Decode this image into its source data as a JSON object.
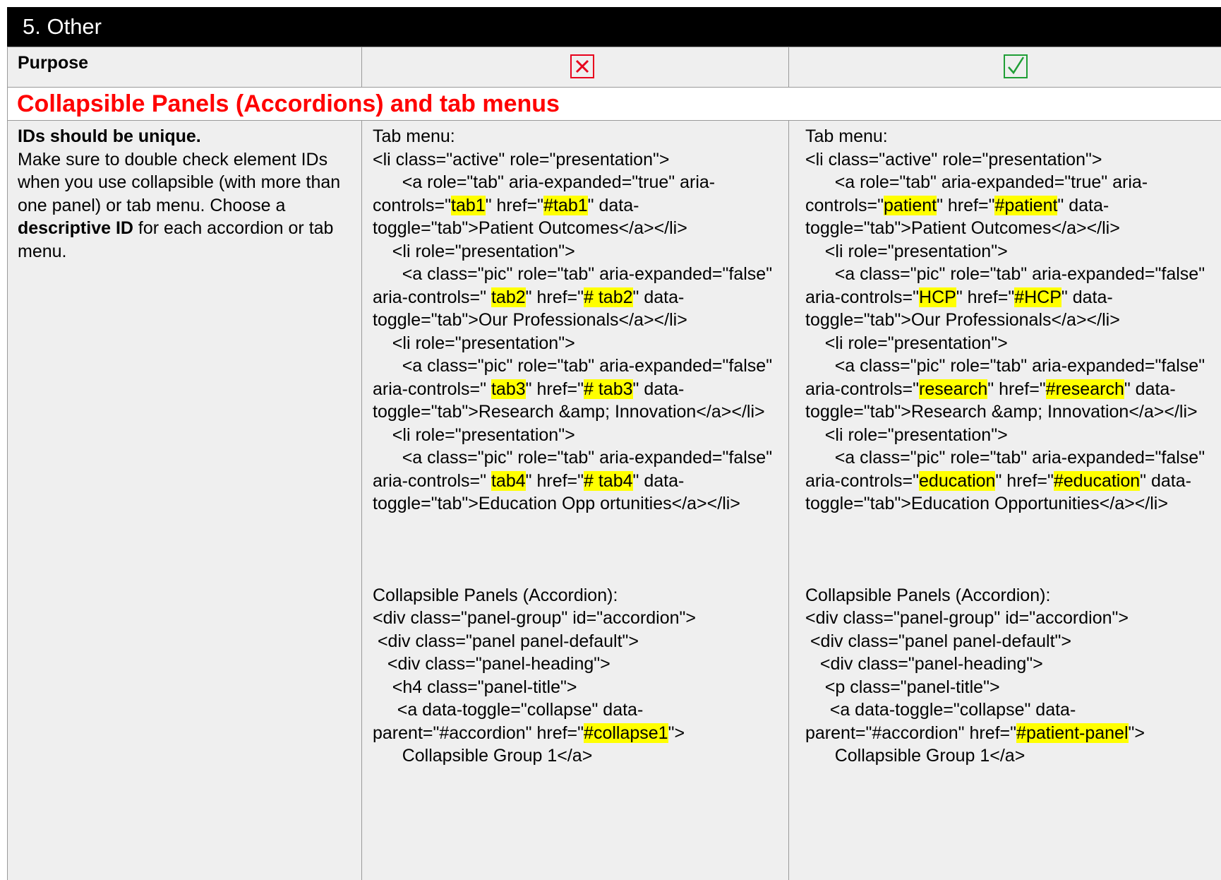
{
  "section": {
    "title": "5.  Other"
  },
  "purpose_row": {
    "label": "Purpose",
    "bad_mark_icon": "red-x-box-icon",
    "good_mark_icon": "green-check-box-icon",
    "colors": {
      "bad": "#e8001c",
      "good": "#1f9f36"
    }
  },
  "topic": {
    "heading": "Collapsible Panels (Accordions) and tab menus",
    "color": "#ff0000"
  },
  "guidance": {
    "title": "IDs should be unique.",
    "text_before": "Make sure to double check element IDs when you use collapsible (with more than one panel) or tab menu. Choose a ",
    "text_bold": "descriptive ID",
    "text_after": " for each accordion or tab menu."
  },
  "bad_example": {
    "tab_label": "Tab menu:",
    "tab_lines": [
      [
        "<li class=\"active\" role=\"presentation\">"
      ],
      [
        "      <a role=\"tab\" aria-expanded=\"true\" aria-controls=\"",
        {
          "hl": "tab1"
        },
        "\" href=\"",
        {
          "hl": "#tab1"
        },
        "\" data-toggle=\"tab\">Patient Outcomes</a></li>"
      ],
      [
        "    <li role=\"presentation\">"
      ],
      [
        "      <a class=\"pic\" role=\"tab\" aria-expanded=\"false\" aria-controls=\" ",
        {
          "hl": "tab2"
        },
        "\" href=\"",
        {
          "hl": "# tab2"
        },
        "\" data-toggle=\"tab\">Our Professionals</a></li>"
      ],
      [
        "    <li role=\"presentation\">"
      ],
      [
        "      <a class=\"pic\" role=\"tab\" aria-expanded=\"false\" aria-controls=\" ",
        {
          "hl": "tab3"
        },
        "\" href=\"",
        {
          "hl": "# tab3"
        },
        "\" data-toggle=\"tab\">Research &amp; Innovation</a></li>"
      ],
      [
        "    <li role=\"presentation\">"
      ],
      [
        "      <a class=\"pic\" role=\"tab\" aria-expanded=\"false\" aria-controls=\" ",
        {
          "hl": "tab4"
        },
        "\" href=\"",
        {
          "hl": "# tab4"
        },
        "\" data-toggle=\"tab\">Education Opp ortunities</a></li>"
      ]
    ],
    "accordion_label": "Collapsible Panels (Accordion):",
    "accordion_lines": [
      [
        "<div class=\"panel-group\" id=\"accordion\">"
      ],
      [
        " <div class=\"panel panel-default\">"
      ],
      [
        "   <div class=\"panel-heading\">"
      ],
      [
        "    <h4 class=\"panel-title\">"
      ],
      [
        "     <a data-toggle=\"collapse\" data-parent=\"#accordion\" href=\"",
        {
          "hl": "#collapse1"
        },
        "\">"
      ],
      [
        "      Collapsible Group 1</a>"
      ]
    ]
  },
  "good_example": {
    "tab_label": "Tab menu:",
    "tab_lines": [
      [
        "<li class=\"active\" role=\"presentation\">"
      ],
      [
        "      <a role=\"tab\" aria-expanded=\"true\" aria-controls=\"",
        {
          "hl": "patient"
        },
        "\" href=\"",
        {
          "hl": "#patient"
        },
        "\" data-toggle=\"tab\">Patient Outcomes</a></li>"
      ],
      [
        "    <li role=\"presentation\">"
      ],
      [
        "      <a class=\"pic\" role=\"tab\" aria-expanded=\"false\" aria-controls=\"",
        {
          "hl": "HCP"
        },
        "\" href=\"",
        {
          "hl": "#HCP"
        },
        "\" data-toggle=\"tab\">Our Professionals</a></li>"
      ],
      [
        "    <li role=\"presentation\">"
      ],
      [
        "      <a class=\"pic\" role=\"tab\" aria-expanded=\"false\" aria-controls=\"",
        {
          "hl": "research"
        },
        "\" href=\"",
        {
          "hl": "#research"
        },
        "\" data-toggle=\"tab\">Research &amp; Innovation</a></li>"
      ],
      [
        "    <li role=\"presentation\">"
      ],
      [
        "      <a class=\"pic\" role=\"tab\" aria-expanded=\"false\" aria-controls=\"",
        {
          "hl": "education"
        },
        "\" href=\"",
        {
          "hl": "#education"
        },
        "\" data-toggle=\"tab\">Education Opportunities</a></li>"
      ]
    ],
    "accordion_label": "Collapsible Panels (Accordion):",
    "accordion_lines": [
      [
        "<div class=\"panel-group\" id=\"accordion\">"
      ],
      [
        " <div class=\"panel panel-default\">"
      ],
      [
        "   <div class=\"panel-heading\">"
      ],
      [
        "    <p class=\"panel-title\">"
      ],
      [
        "     <a data-toggle=\"collapse\" data-parent=\"#accordion\" href=\"",
        {
          "hl": "#patient-panel"
        },
        "\">"
      ],
      [
        "      Collapsible Group 1</a>"
      ]
    ]
  }
}
